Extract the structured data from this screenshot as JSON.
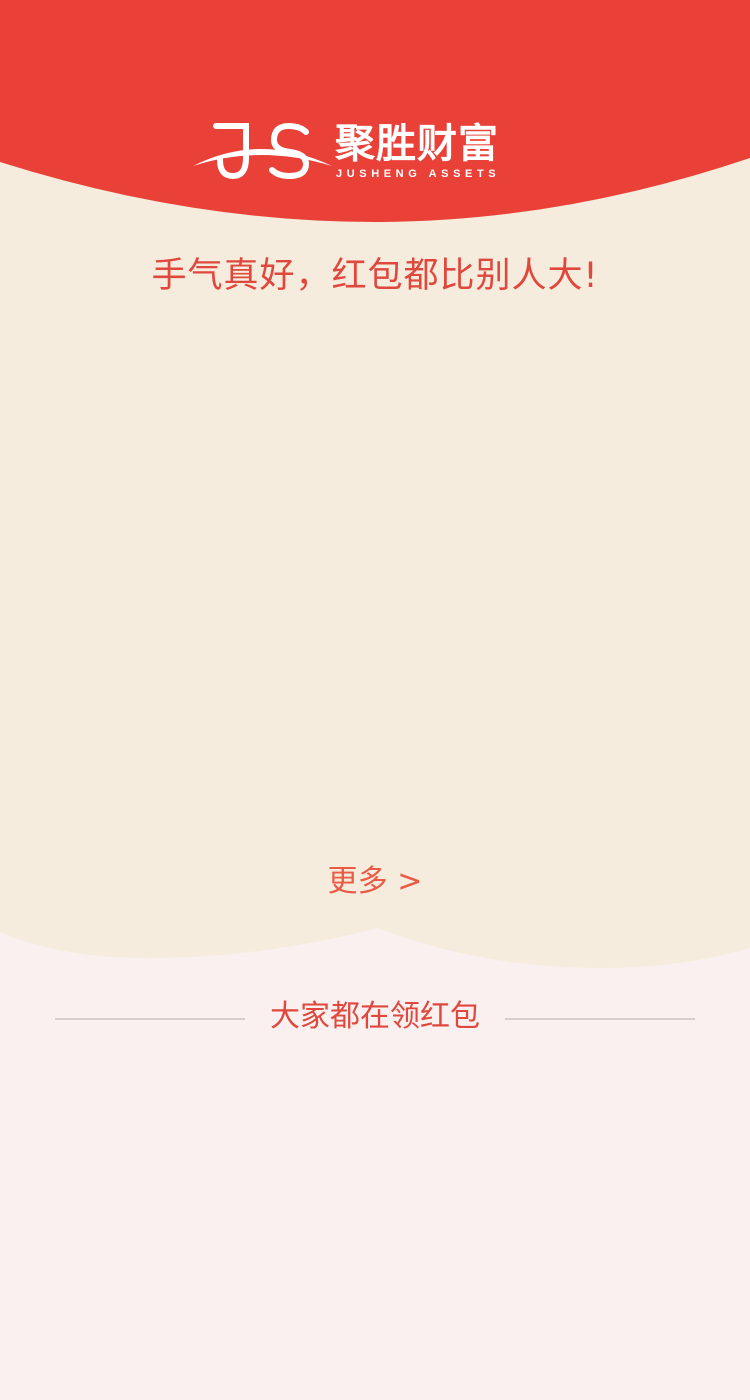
{
  "brand": {
    "name_cn": "聚胜财富",
    "name_en": "JUSHENG ASSETS",
    "logo_icon": "js-monogram-logo"
  },
  "headline": "手气真好，红包都比别人大!",
  "more_link": "更多 >",
  "section": {
    "title": "大家都在领红包"
  },
  "colors": {
    "header_red": "#e94138",
    "cream": "#f5ecdd",
    "page_bg": "#f9f0ef",
    "accent_text": "#e0473d",
    "divider": "#d9cccb"
  }
}
